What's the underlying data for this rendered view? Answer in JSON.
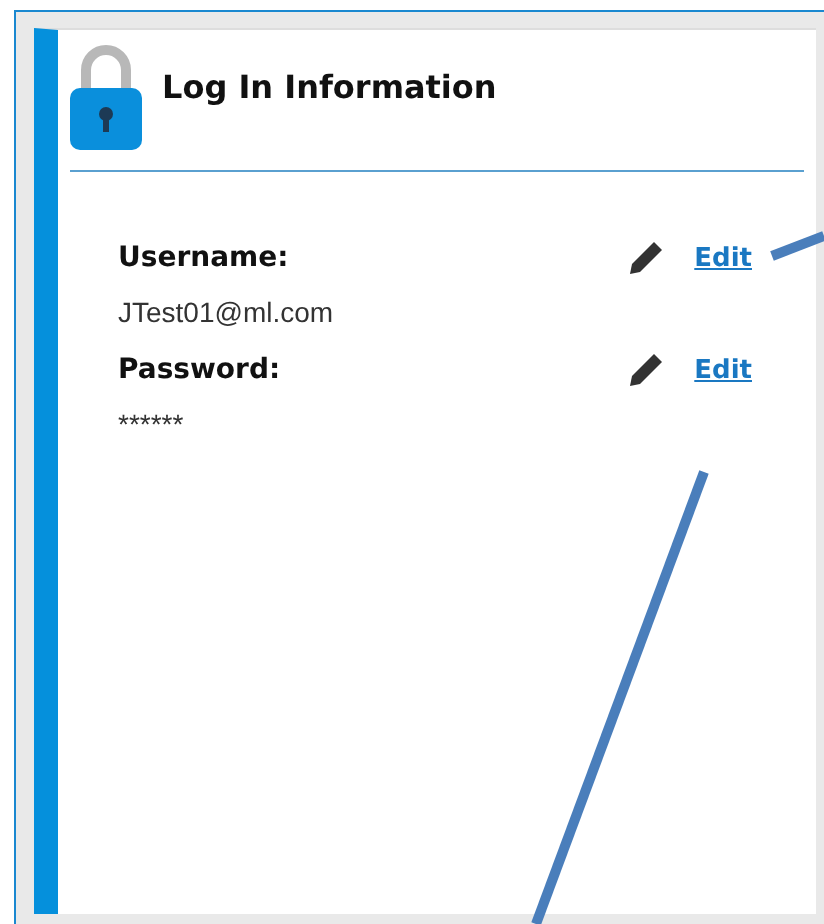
{
  "card": {
    "title": "Log In Information"
  },
  "fields": [
    {
      "label": "Username:",
      "value": "JTest01@ml.com",
      "action": "Edit"
    },
    {
      "label": "Password:",
      "value": "******",
      "action": "Edit"
    }
  ]
}
